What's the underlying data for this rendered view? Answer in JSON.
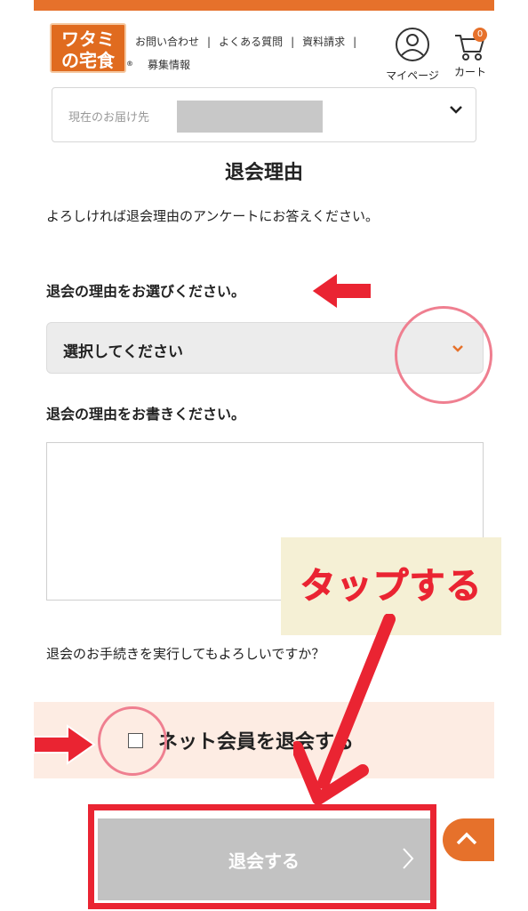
{
  "header": {
    "logo_line1": "ワタミ",
    "logo_line2": "の宅食",
    "logo_mark": "®",
    "links": [
      "お問い合わせ",
      "よくある質問",
      "資料請求",
      "募集情報"
    ],
    "mypage_label": "マイページ",
    "cart_label": "カート",
    "cart_count": "0",
    "accent_color": "#e6712b"
  },
  "delivery": {
    "label": "現在のお届け先"
  },
  "form": {
    "title": "退会理由",
    "intro": "よろしければ退会理由のアンケートにお答えください。",
    "reason_select_label": "退会の理由をお選びください。",
    "reason_select_value": "選択してください",
    "reason_text_label": "退会の理由をお書きください。",
    "reason_text_value": "",
    "confirm_question": "退会のお手続きを実行してもよろしいですか？",
    "consent_label": "ネット会員を退会する",
    "consent_checked": false,
    "submit_label": "退会する"
  },
  "annotations": {
    "tap_callout": "タップする",
    "highlight_color": "#ea2432"
  },
  "icons": {
    "user": "user-circle-icon",
    "cart": "cart-icon",
    "chevron_down": "chevron-down-icon",
    "chevron_right": "chevron-right-icon",
    "chevron_up": "chevron-up-icon"
  }
}
